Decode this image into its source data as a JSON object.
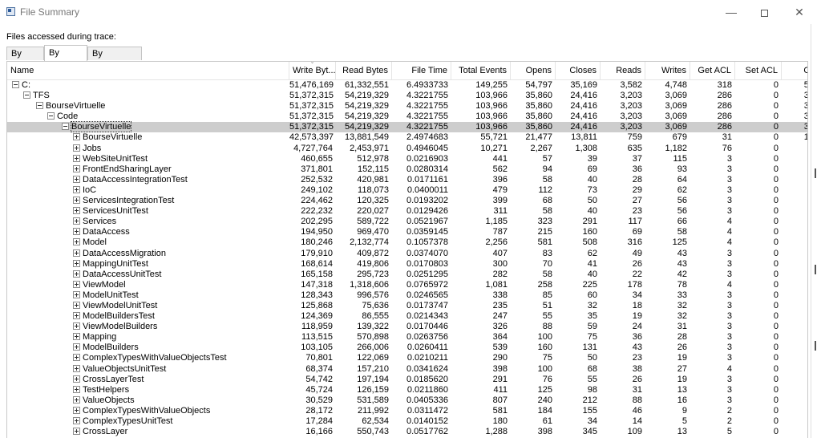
{
  "window": {
    "title": "File Summary",
    "minimize": "—",
    "close": "✕"
  },
  "label": "Files accessed during trace:",
  "tabs": [
    "By Path",
    "By Folder",
    "By Extension"
  ],
  "columns": [
    "Name",
    "Write Byt...",
    "Read Bytes",
    "File Time",
    "Total Events",
    "Opens",
    "Closes",
    "Reads",
    "Writes",
    "Get ACL",
    "Set ACL",
    "Ot"
  ],
  "rows": [
    {
      "name": "C:",
      "level": 0,
      "exp": "minus",
      "v": [
        "51,476,169",
        "61,332,551",
        "6.4933733",
        "149,255",
        "54,797",
        "35,169",
        "3,582",
        "4,748",
        "318",
        "0",
        "50"
      ]
    },
    {
      "name": "TFS",
      "level": 1,
      "exp": "minus",
      "v": [
        "51,372,315",
        "54,219,329",
        "4.3221755",
        "103,966",
        "35,860",
        "24,416",
        "3,203",
        "3,069",
        "286",
        "0",
        "37"
      ]
    },
    {
      "name": "BourseVirtuelle",
      "level": 2,
      "exp": "minus",
      "v": [
        "51,372,315",
        "54,219,329",
        "4.3221755",
        "103,966",
        "35,860",
        "24,416",
        "3,203",
        "3,069",
        "286",
        "0",
        "37"
      ]
    },
    {
      "name": "Code",
      "level": 3,
      "exp": "minus",
      "v": [
        "51,372,315",
        "54,219,329",
        "4.3221755",
        "103,966",
        "35,860",
        "24,416",
        "3,203",
        "3,069",
        "286",
        "0",
        "37"
      ]
    },
    {
      "name": "BourseVirtuelle",
      "level": 4,
      "exp": "minus",
      "selected": true,
      "v": [
        "51,372,315",
        "54,219,329",
        "4.3221755",
        "103,966",
        "35,860",
        "24,416",
        "3,203",
        "3,069",
        "286",
        "0",
        "37"
      ]
    },
    {
      "name": "BourseVirtuelle",
      "level": 5,
      "exp": "plus",
      "v": [
        "42,573,397",
        "13,881,549",
        "2.4974683",
        "55,721",
        "21,477",
        "13,811",
        "759",
        "679",
        "31",
        "0",
        "18"
      ]
    },
    {
      "name": "Jobs",
      "level": 5,
      "exp": "plus",
      "v": [
        "4,727,764",
        "2,453,971",
        "0.4946045",
        "10,271",
        "2,267",
        "1,308",
        "635",
        "1,182",
        "76",
        "0",
        "4"
      ]
    },
    {
      "name": "WebSiteUnitTest",
      "level": 5,
      "exp": "plus",
      "v": [
        "460,655",
        "512,978",
        "0.0216903",
        "441",
        "57",
        "39",
        "37",
        "115",
        "3",
        "0",
        ""
      ]
    },
    {
      "name": "FrontEndSharingLayer",
      "level": 5,
      "exp": "plus",
      "v": [
        "371,801",
        "152,115",
        "0.0280314",
        "562",
        "94",
        "69",
        "36",
        "93",
        "3",
        "0",
        ""
      ]
    },
    {
      "name": "DataAccessIntegrationTest",
      "level": 5,
      "exp": "plus",
      "v": [
        "252,532",
        "420,981",
        "0.0171161",
        "396",
        "58",
        "40",
        "28",
        "64",
        "3",
        "0",
        ""
      ]
    },
    {
      "name": "IoC",
      "level": 5,
      "exp": "plus",
      "v": [
        "249,102",
        "118,073",
        "0.0400011",
        "479",
        "112",
        "73",
        "29",
        "62",
        "3",
        "0",
        ""
      ]
    },
    {
      "name": "ServicesIntegrationTest",
      "level": 5,
      "exp": "plus",
      "v": [
        "224,462",
        "120,325",
        "0.0193202",
        "399",
        "68",
        "50",
        "27",
        "56",
        "3",
        "0",
        ""
      ]
    },
    {
      "name": "ServicesUnitTest",
      "level": 5,
      "exp": "plus",
      "v": [
        "222,232",
        "220,027",
        "0.0129426",
        "311",
        "58",
        "40",
        "23",
        "56",
        "3",
        "0",
        ""
      ]
    },
    {
      "name": "Services",
      "level": 5,
      "exp": "plus",
      "v": [
        "202,295",
        "589,722",
        "0.0521967",
        "1,185",
        "323",
        "291",
        "117",
        "66",
        "4",
        "0",
        ""
      ]
    },
    {
      "name": "DataAccess",
      "level": 5,
      "exp": "plus",
      "v": [
        "194,950",
        "969,470",
        "0.0359145",
        "787",
        "215",
        "160",
        "69",
        "58",
        "4",
        "0",
        ""
      ]
    },
    {
      "name": "Model",
      "level": 5,
      "exp": "plus",
      "v": [
        "180,246",
        "2,132,774",
        "0.1057378",
        "2,256",
        "581",
        "508",
        "316",
        "125",
        "4",
        "0",
        ""
      ]
    },
    {
      "name": "DataAccessMigration",
      "level": 5,
      "exp": "plus",
      "v": [
        "179,910",
        "409,872",
        "0.0374070",
        "407",
        "83",
        "62",
        "49",
        "43",
        "3",
        "0",
        ""
      ]
    },
    {
      "name": "MappingUnitTest",
      "level": 5,
      "exp": "plus",
      "v": [
        "168,614",
        "419,806",
        "0.0170803",
        "300",
        "70",
        "41",
        "26",
        "43",
        "3",
        "0",
        ""
      ]
    },
    {
      "name": "DataAccessUnitTest",
      "level": 5,
      "exp": "plus",
      "v": [
        "165,158",
        "295,723",
        "0.0251295",
        "282",
        "58",
        "40",
        "22",
        "42",
        "3",
        "0",
        ""
      ]
    },
    {
      "name": "ViewModel",
      "level": 5,
      "exp": "plus",
      "v": [
        "147,318",
        "1,318,606",
        "0.0765972",
        "1,081",
        "258",
        "225",
        "178",
        "78",
        "4",
        "0",
        ""
      ]
    },
    {
      "name": "ModelUnitTest",
      "level": 5,
      "exp": "plus",
      "v": [
        "128,343",
        "996,576",
        "0.0246565",
        "338",
        "85",
        "60",
        "34",
        "33",
        "3",
        "0",
        ""
      ]
    },
    {
      "name": "ViewModelUnitTest",
      "level": 5,
      "exp": "plus",
      "v": [
        "125,868",
        "75,636",
        "0.0173747",
        "235",
        "51",
        "32",
        "18",
        "32",
        "3",
        "0",
        ""
      ]
    },
    {
      "name": "ModelBuildersTest",
      "level": 5,
      "exp": "plus",
      "v": [
        "124,369",
        "86,555",
        "0.0214343",
        "247",
        "55",
        "35",
        "19",
        "32",
        "3",
        "0",
        ""
      ]
    },
    {
      "name": "ViewModelBuilders",
      "level": 5,
      "exp": "plus",
      "v": [
        "118,959",
        "139,322",
        "0.0170446",
        "326",
        "88",
        "59",
        "24",
        "31",
        "3",
        "0",
        ""
      ]
    },
    {
      "name": "Mapping",
      "level": 5,
      "exp": "plus",
      "v": [
        "113,515",
        "570,898",
        "0.0263756",
        "364",
        "100",
        "75",
        "36",
        "28",
        "3",
        "0",
        ""
      ]
    },
    {
      "name": "ModelBuilders",
      "level": 5,
      "exp": "plus",
      "v": [
        "103,105",
        "266,006",
        "0.0260411",
        "539",
        "160",
        "131",
        "43",
        "26",
        "3",
        "0",
        ""
      ]
    },
    {
      "name": "ComplexTypesWithValueObjectsTest",
      "level": 5,
      "exp": "plus",
      "v": [
        "70,801",
        "122,069",
        "0.0210211",
        "290",
        "75",
        "50",
        "23",
        "19",
        "3",
        "0",
        ""
      ]
    },
    {
      "name": "ValueObjectsUnitTest",
      "level": 5,
      "exp": "plus",
      "v": [
        "68,374",
        "157,210",
        "0.0341624",
        "398",
        "100",
        "68",
        "38",
        "27",
        "4",
        "0",
        ""
      ]
    },
    {
      "name": "CrossLayerTest",
      "level": 5,
      "exp": "plus",
      "v": [
        "54,742",
        "197,194",
        "0.0185620",
        "291",
        "76",
        "55",
        "26",
        "19",
        "3",
        "0",
        ""
      ]
    },
    {
      "name": "TestHelpers",
      "level": 5,
      "exp": "plus",
      "v": [
        "45,724",
        "126,159",
        "0.0211860",
        "411",
        "125",
        "98",
        "31",
        "13",
        "3",
        "0",
        ""
      ]
    },
    {
      "name": "ValueObjects",
      "level": 5,
      "exp": "plus",
      "v": [
        "30,529",
        "531,589",
        "0.0405336",
        "807",
        "240",
        "212",
        "88",
        "16",
        "3",
        "0",
        ""
      ]
    },
    {
      "name": "ComplexTypesWithValueObjects",
      "level": 5,
      "exp": "plus",
      "v": [
        "28,172",
        "211,992",
        "0.0311472",
        "581",
        "184",
        "155",
        "46",
        "9",
        "2",
        "0",
        ""
      ]
    },
    {
      "name": "ComplexTypesUnitTest",
      "level": 5,
      "exp": "plus",
      "v": [
        "17,284",
        "62,534",
        "0.0140152",
        "180",
        "61",
        "34",
        "14",
        "5",
        "2",
        "0",
        ""
      ]
    },
    {
      "name": "CrossLayer",
      "level": 5,
      "exp": "plus",
      "v": [
        "16,166",
        "550,743",
        "0.0517762",
        "1,288",
        "398",
        "345",
        "109",
        "13",
        "5",
        "0",
        ""
      ]
    }
  ]
}
